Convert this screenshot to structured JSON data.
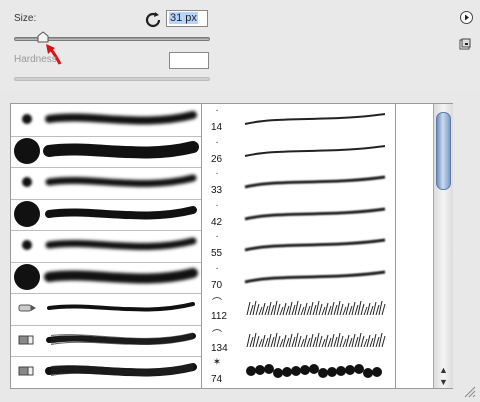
{
  "size": {
    "label": "Size:",
    "value": "31 px",
    "slider_fraction": 0.15
  },
  "hardness": {
    "label": "Hardness",
    "value": ""
  },
  "icons": {
    "reset": "reset-icon",
    "menu": "panel-menu-icon",
    "new_preset": "new-preset-icon",
    "pointer": "red-arrow-annotation",
    "resize": "resize-grip-icon"
  },
  "brushes_left": [
    {
      "tip": "soft-small",
      "stroke": "soft"
    },
    {
      "tip": "hard-large",
      "stroke": "hard"
    },
    {
      "tip": "soft-small",
      "stroke": "soft-taper"
    },
    {
      "tip": "hard-large",
      "stroke": "hard-taper"
    },
    {
      "tip": "soft-small",
      "stroke": "soft-taper"
    },
    {
      "tip": "hard-large",
      "stroke": "soft-wide"
    },
    {
      "tip": "pencil-icon",
      "stroke": "thin-taper"
    },
    {
      "tip": "brush-icon",
      "stroke": "streaky"
    },
    {
      "tip": "brush-icon",
      "stroke": "streaky-multi"
    }
  ],
  "brushes_right": [
    {
      "size": "14",
      "kind": "stroke"
    },
    {
      "size": "26",
      "kind": "stroke"
    },
    {
      "size": "33",
      "kind": "stroke"
    },
    {
      "size": "42",
      "kind": "stroke"
    },
    {
      "size": "55",
      "kind": "stroke"
    },
    {
      "size": "70",
      "kind": "stroke"
    },
    {
      "size": "112",
      "kind": "grass"
    },
    {
      "size": "134",
      "kind": "grass"
    },
    {
      "size": "74",
      "kind": "leaves"
    }
  ],
  "scrollbar": {
    "up": "▲",
    "down": "▼"
  }
}
